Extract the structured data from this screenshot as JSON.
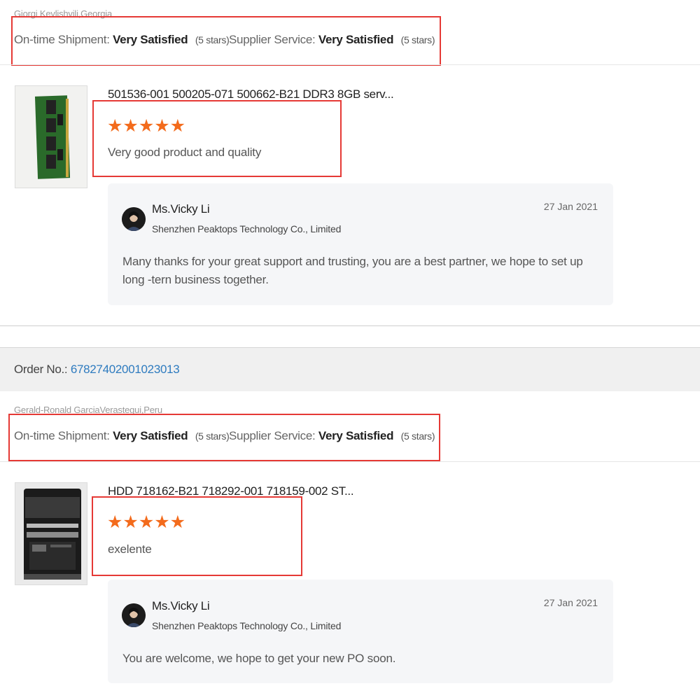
{
  "reviews": [
    {
      "buyer": "Giorgi Kevlishvili,Georgia",
      "shipment_label": "On-time Shipment:",
      "shipment_value": "Very Satisfied",
      "shipment_count": "(5 stars)",
      "service_label": "Supplier Service:",
      "service_value": "Very Satisfied",
      "service_count": "(5 stars)",
      "product_title": "501536-001 500205-071 500662-B21 DDR3 8GB serv...",
      "rating": 5,
      "stars": "★★★★★",
      "comment": "Very good product and quality",
      "reply": {
        "name": "Ms.Vicky Li",
        "company": "Shenzhen Peaktops Technology Co., Limited",
        "date": "27 Jan 2021",
        "text": "Many thanks for your great support and trusting, you are a best partner, we hope to set up long -tern business together."
      }
    },
    {
      "buyer": "Gerald-Ronald GarciaVerastegui,Peru",
      "shipment_label": "On-time Shipment:",
      "shipment_value": "Very Satisfied",
      "shipment_count": "(5 stars)",
      "service_label": "Supplier Service:",
      "service_value": "Very Satisfied",
      "service_count": "(5 stars)",
      "product_title": "HDD 718162-B21 718292-001 718159-002 ST...",
      "rating": 5,
      "stars": "★★★★★",
      "comment": "exelente",
      "reply": {
        "name": "Ms.Vicky Li",
        "company": "Shenzhen Peaktops Technology Co., Limited",
        "date": "27 Jan 2021",
        "text": "You are welcome, we hope to get your new PO soon."
      }
    }
  ],
  "order": {
    "label": "Order No.:",
    "number": "67827402001023013"
  },
  "colors": {
    "star": "#f36b1c",
    "highlight_box": "#e53935",
    "order_link": "#2e7bbf",
    "reply_bg": "#f5f6f8"
  }
}
